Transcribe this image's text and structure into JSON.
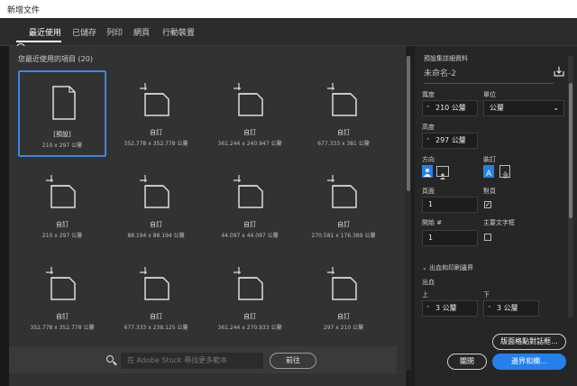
{
  "window": {
    "title": "新增文件"
  },
  "tabs": [
    {
      "label": "最近使用",
      "active": true
    },
    {
      "label": "已儲存"
    },
    {
      "label": "列印"
    },
    {
      "label": "網頁"
    },
    {
      "label": "行動裝置"
    }
  ],
  "recent": {
    "heading": "您最近使用的項目 (20)",
    "items": [
      {
        "name": "[預設]",
        "size": "210 x 297 公釐",
        "selected": true,
        "icon": "document-icon"
      },
      {
        "name": "自訂",
        "size": "352.778 x 352.778 公釐",
        "icon": "artboard-icon"
      },
      {
        "name": "自訂",
        "size": "361.244 x 240.947 公釐",
        "icon": "artboard-icon"
      },
      {
        "name": "自訂",
        "size": "677.333 x 381 公釐",
        "icon": "artboard-icon"
      },
      {
        "name": "自訂",
        "size": "210 x 297 公釐",
        "icon": "artboard-icon"
      },
      {
        "name": "自訂",
        "size": "88.194 x 88.194 公釐",
        "icon": "artboard-icon"
      },
      {
        "name": "自訂",
        "size": "44.097 x 44.097 公釐",
        "icon": "artboard-icon"
      },
      {
        "name": "自訂",
        "size": "270.581 x 176.389 公釐",
        "icon": "artboard-icon"
      },
      {
        "name": "自訂",
        "size": "352.778 x 352.778 公釐",
        "icon": "artboard-icon"
      },
      {
        "name": "自訂",
        "size": "677.333 x 238.125 公釐",
        "icon": "artboard-icon"
      },
      {
        "name": "自訂",
        "size": "361.244 x 270.933 公釐",
        "icon": "artboard-icon"
      },
      {
        "name": "自訂",
        "size": "297 x 210 公釐",
        "icon": "artboard-icon"
      }
    ]
  },
  "search": {
    "placeholder": "在 Adobe Stock 尋找更多範本",
    "go_label": "前往"
  },
  "preset": {
    "heading": "預設集詳細資料",
    "doc_name": "未命名-2",
    "width_label": "寬度",
    "width_value": "210 公釐",
    "unit_label": "單位",
    "unit_value": "公釐",
    "height_label": "高度",
    "height_value": "297 公釐",
    "orientation_label": "方向",
    "binding_label": "裝訂",
    "pages_label": "頁面",
    "pages_value": "1",
    "facing_label": "對頁",
    "facing_checked": true,
    "start_label": "開始 #",
    "start_value": "1",
    "master_label": "主要文字框",
    "master_checked": false,
    "bleed_section": "出血和印刷邊界",
    "bleed_label": "出血",
    "top_label": "上",
    "top_value": "3 公釐",
    "bottom_label": "下",
    "bottom_value": "3 公釐"
  },
  "buttons": {
    "layout_grid": "版面格點對話框...",
    "close": "關閉",
    "margins": "邊界和欄..."
  },
  "colors": {
    "accent": "#2680eb",
    "selection": "#3b87e6"
  }
}
